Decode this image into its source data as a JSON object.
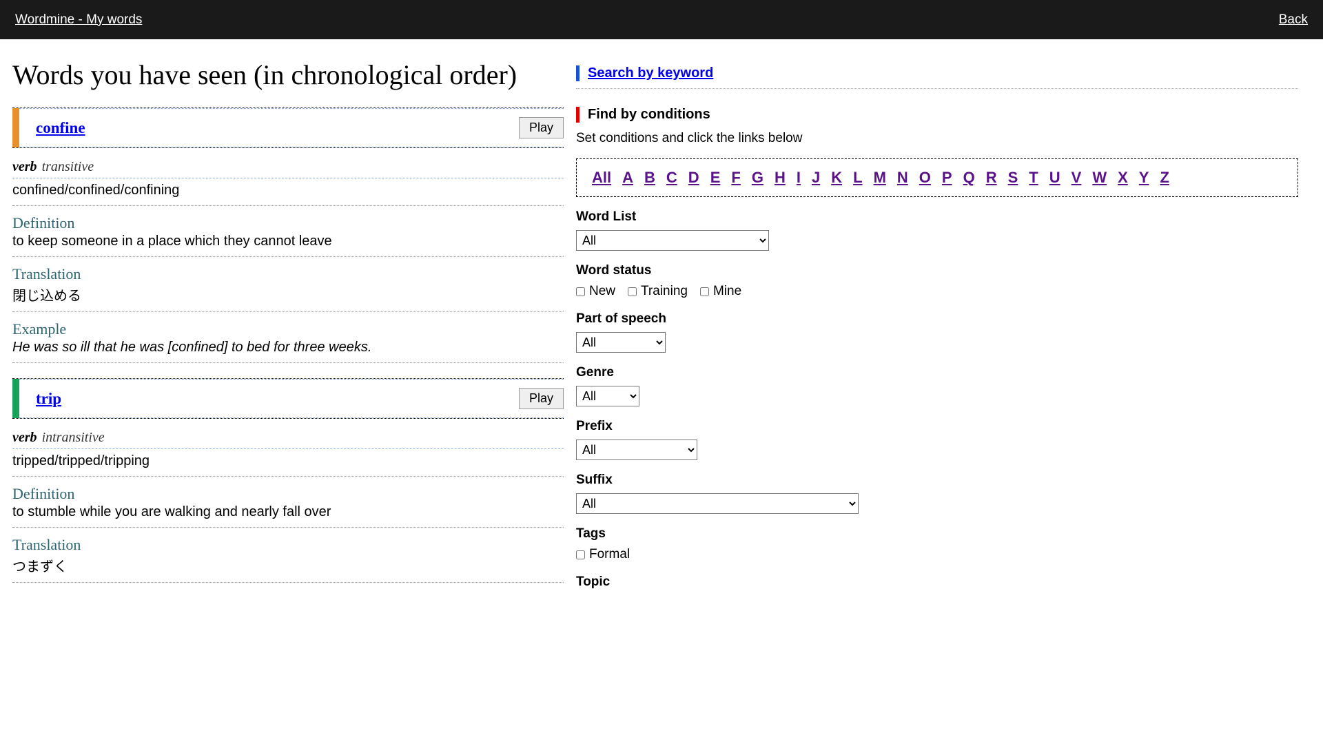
{
  "header": {
    "brand": "Wordmine - My words",
    "back": "Back"
  },
  "title": "Words you have seen (in chronological order)",
  "play_label": "Play",
  "entries": [
    {
      "word": "confine",
      "color": "#e8912b",
      "pos": "verb",
      "transitivity": "transitive",
      "forms": "confined/confined/confining",
      "def_label": "Definition",
      "definition": "to keep someone in a place which they cannot leave",
      "trans_label": "Translation",
      "translation": "閉じ込める",
      "ex_label": "Example",
      "example": "He was so ill that he was [confined] to bed for three weeks."
    },
    {
      "word": "trip",
      "color": "#17a35a",
      "pos": "verb",
      "transitivity": "intransitive",
      "forms": "tripped/tripped/tripping",
      "def_label": "Definition",
      "definition": "to stumble while you are walking and nearly fall over",
      "trans_label": "Translation",
      "translation": "つまずく"
    }
  ],
  "sidebar": {
    "search_heading": "Search by keyword",
    "find_heading": "Find by conditions",
    "find_note": "Set conditions and click the links below",
    "alpha": [
      "All",
      "A",
      "B",
      "C",
      "D",
      "E",
      "F",
      "G",
      "H",
      "I",
      "J",
      "K",
      "L",
      "M",
      "N",
      "O",
      "P",
      "Q",
      "R",
      "S",
      "T",
      "U",
      "V",
      "W",
      "X",
      "Y",
      "Z"
    ],
    "labels": {
      "wordlist": "Word List",
      "status": "Word status",
      "pos": "Part of speech",
      "genre": "Genre",
      "prefix": "Prefix",
      "suffix": "Suffix",
      "tags": "Tags",
      "topic": "Topic"
    },
    "select_all": "All",
    "status_options": [
      "New",
      "Training",
      "Mine"
    ],
    "tag_options": [
      "Formal"
    ]
  }
}
